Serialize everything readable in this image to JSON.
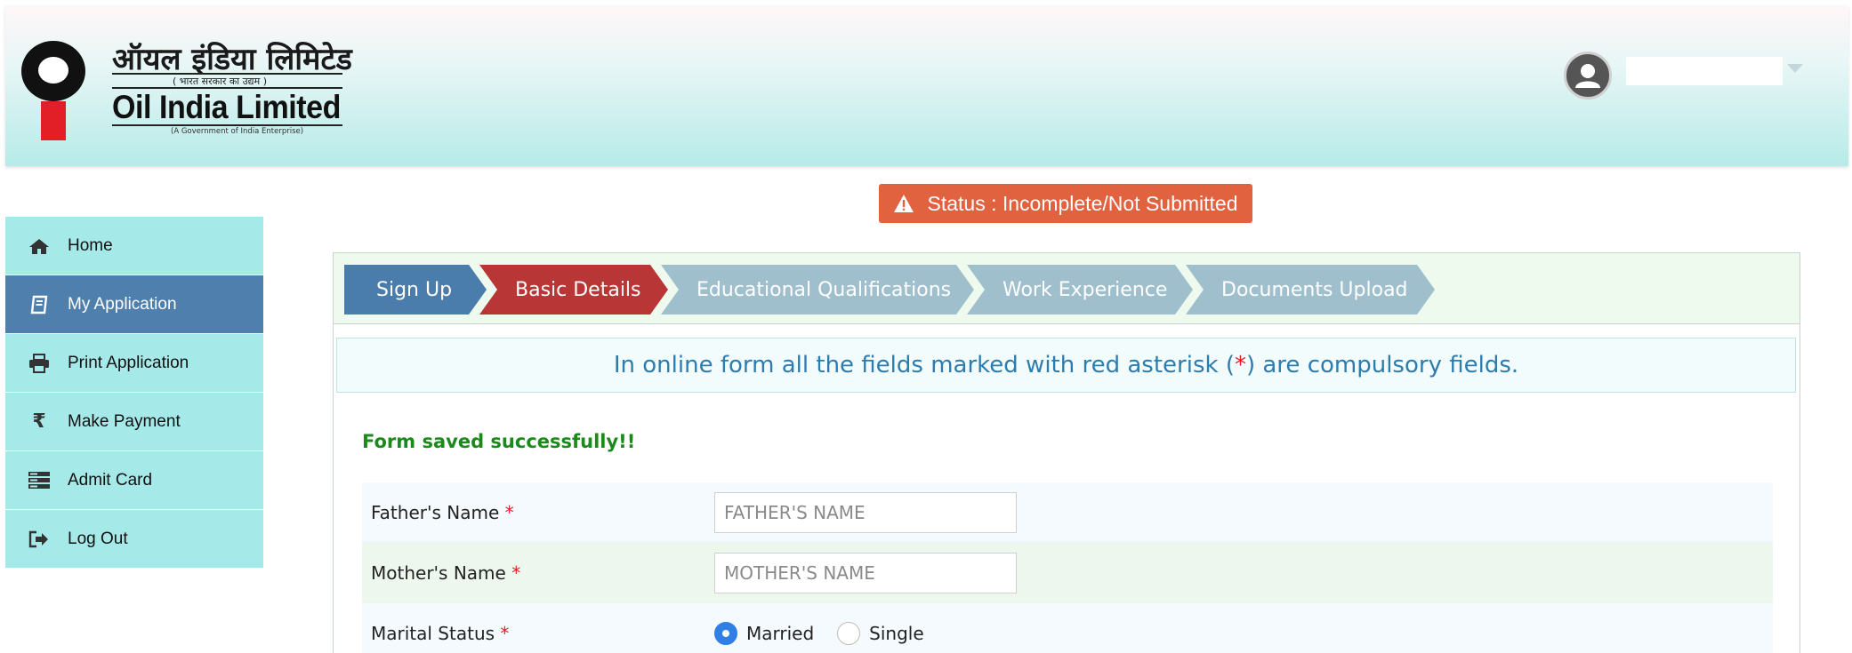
{
  "header": {
    "logo_hindi": "ऑयल इंडिया लिमिटेड",
    "logo_hindi_sub": "( भारत सरकार का उद्यम )",
    "logo_english": "Oil India Limited",
    "logo_english_sub": "(A Government of India Enterprise)"
  },
  "status": {
    "text": "Status : Incomplete/Not Submitted",
    "icon": "warning-icon",
    "color": "#e0623e"
  },
  "sidebar": {
    "items": [
      {
        "label": "Home",
        "icon": "home-icon"
      },
      {
        "label": "My Application",
        "icon": "book-icon",
        "active": true
      },
      {
        "label": "Print Application",
        "icon": "printer-icon"
      },
      {
        "label": "Make Payment",
        "icon": "rupee-icon"
      },
      {
        "label": "Admit Card",
        "icon": "card-icon"
      },
      {
        "label": "Log Out",
        "icon": "logout-icon"
      }
    ]
  },
  "steps": [
    {
      "label": "Sign Up",
      "state": "done",
      "color": "#4a7dab"
    },
    {
      "label": "Basic Details",
      "state": "current",
      "color": "#b93636"
    },
    {
      "label": "Educational Qualifications",
      "state": "pending",
      "color": "#9fbfcd"
    },
    {
      "label": "Work Experience",
      "state": "pending",
      "color": "#9fbfcd"
    },
    {
      "label": "Documents Upload",
      "state": "pending",
      "color": "#9fbfcd"
    }
  ],
  "notice": {
    "before": "In online form all the fields marked with red asterisk (",
    "asterisk": "*",
    "after": ") are compulsory fields."
  },
  "saved_message": "Form saved successfully!!",
  "form": {
    "fathers_name": {
      "label": "Father's Name",
      "required": "*",
      "placeholder": "FATHER'S NAME",
      "value": ""
    },
    "mothers_name": {
      "label": "Mother's Name",
      "required": "*",
      "placeholder": "MOTHER'S NAME",
      "value": ""
    },
    "marital_status": {
      "label": "Marital Status",
      "required": "*",
      "options": [
        "Married",
        "Single"
      ],
      "selected": "Married"
    }
  }
}
